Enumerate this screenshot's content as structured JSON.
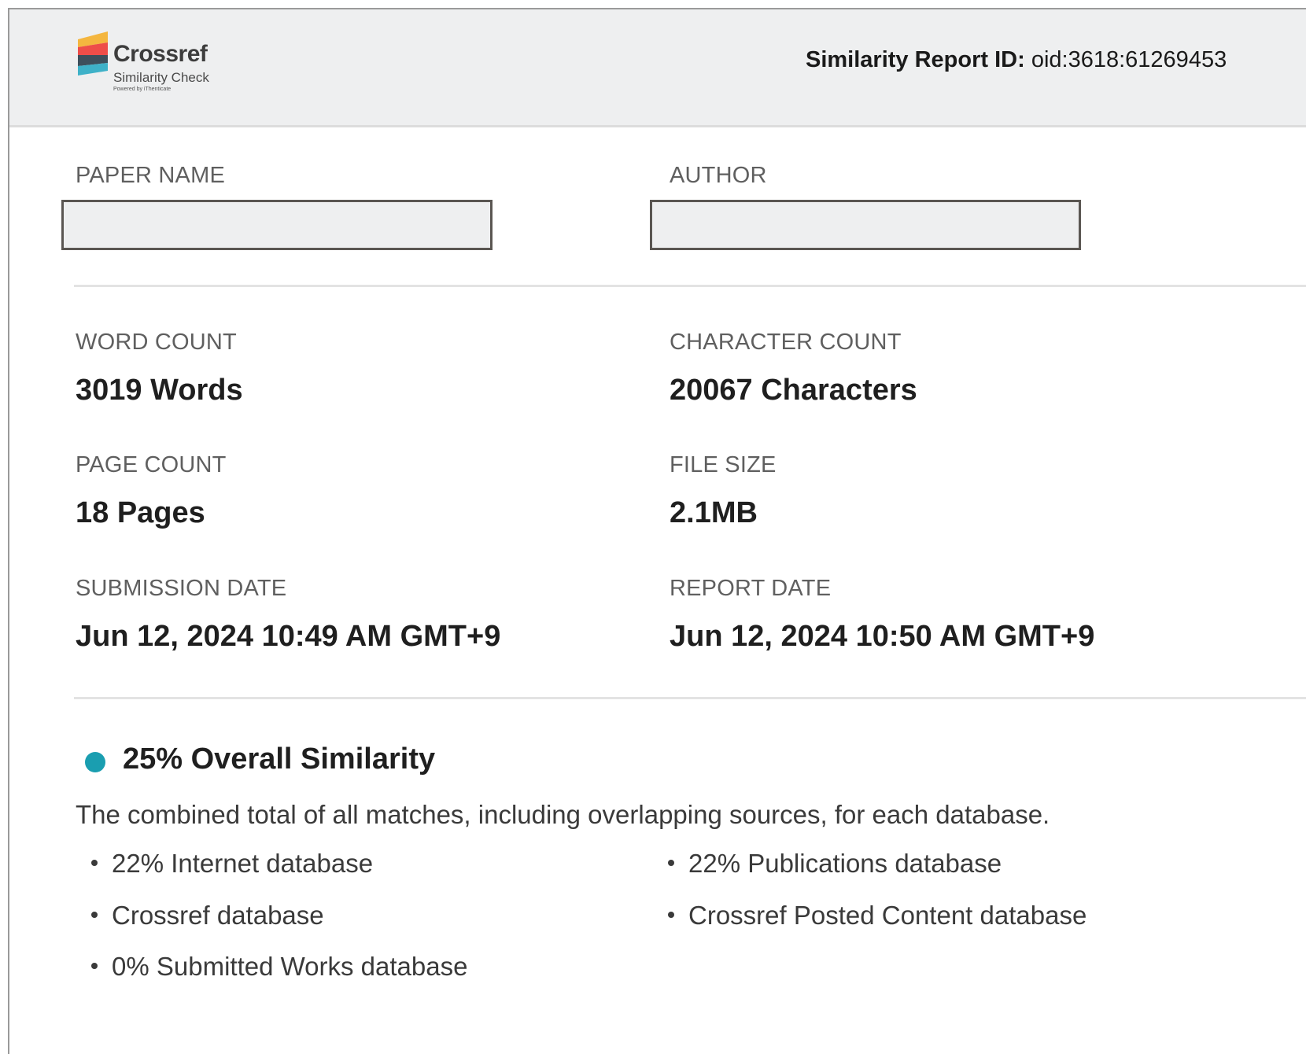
{
  "header": {
    "logo": {
      "name": "Crossref",
      "subtitle": "Similarity Check",
      "powered_by": "Powered by iThenticate"
    },
    "report_id_label": "Similarity Report ID:",
    "report_id_value": "oid:3618:61269453"
  },
  "fields": {
    "paper_name_label": "PAPER NAME",
    "author_label": "AUTHOR",
    "word_count_label": "WORD COUNT",
    "word_count_value": "3019 Words",
    "character_count_label": "CHARACTER COUNT",
    "character_count_value": "20067 Characters",
    "page_count_label": "PAGE COUNT",
    "page_count_value": "18 Pages",
    "file_size_label": "FILE SIZE",
    "file_size_value": "2.1MB",
    "submission_date_label": "SUBMISSION DATE",
    "submission_date_value": "Jun 12, 2024 10:49 AM GMT+9",
    "report_date_label": "REPORT DATE",
    "report_date_value": "Jun 12, 2024 10:50 AM GMT+9"
  },
  "similarity": {
    "title": "25% Overall Similarity",
    "description": "The combined total of all matches, including overlapping sources, for each database.",
    "indicator_color": "#1a9eb0",
    "databases_left": [
      "22% Internet database",
      "Crossref database",
      "0% Submitted Works database"
    ],
    "databases_right": [
      "22% Publications database",
      "Crossref Posted Content database"
    ]
  }
}
